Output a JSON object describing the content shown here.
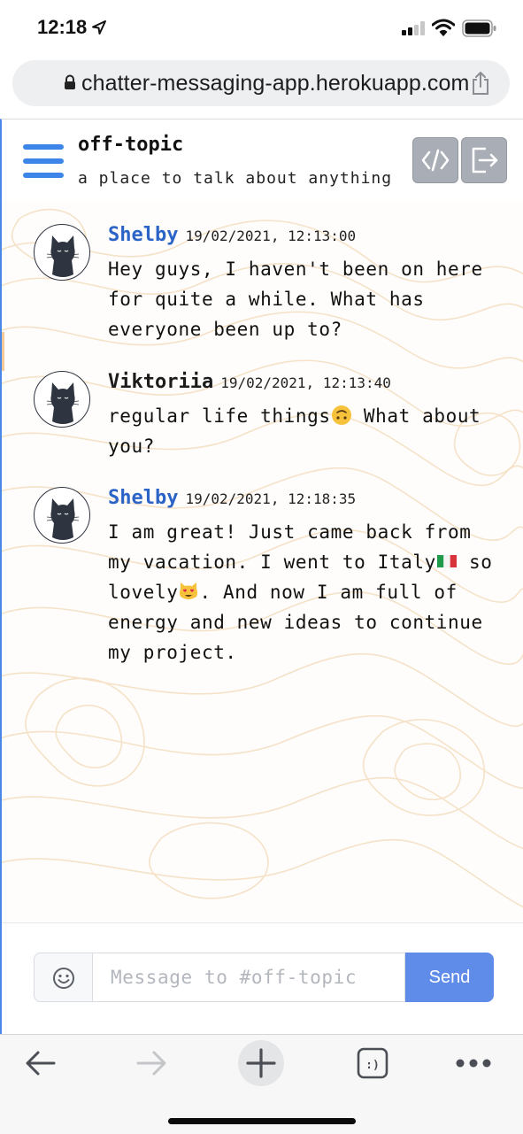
{
  "status": {
    "time": "12:18"
  },
  "browser": {
    "url": "chatter-messaging-app.herokuapp.com"
  },
  "channel": {
    "name": "off-topic",
    "description": "a place to talk about anything"
  },
  "messages": [
    {
      "user": "Shelby",
      "timestamp": "19/02/2021, 12:13:00",
      "text": "Hey guys, I haven't been on here for quite a while. What has everyone been up to?"
    },
    {
      "user": "Viktoriia",
      "timestamp": "19/02/2021, 12:13:40",
      "text_before": "regular life things",
      "text_after": " What about you?"
    },
    {
      "user": "Shelby",
      "timestamp": "19/02/2021, 12:18:35",
      "text_part1": "I am great! Just came back from my vacation. I went to Italy",
      "text_part2": " so lovely",
      "text_part3": ". And now I am full of energy and new ideas to continue my project."
    }
  ],
  "composer": {
    "placeholder": "Message to #off-topic",
    "send_label": "Send"
  },
  "colors": {
    "accent": "#3b86e8",
    "username_blue": "#2b63c7",
    "send": "#5f8ce8",
    "header_button": "#a9aeb6"
  }
}
